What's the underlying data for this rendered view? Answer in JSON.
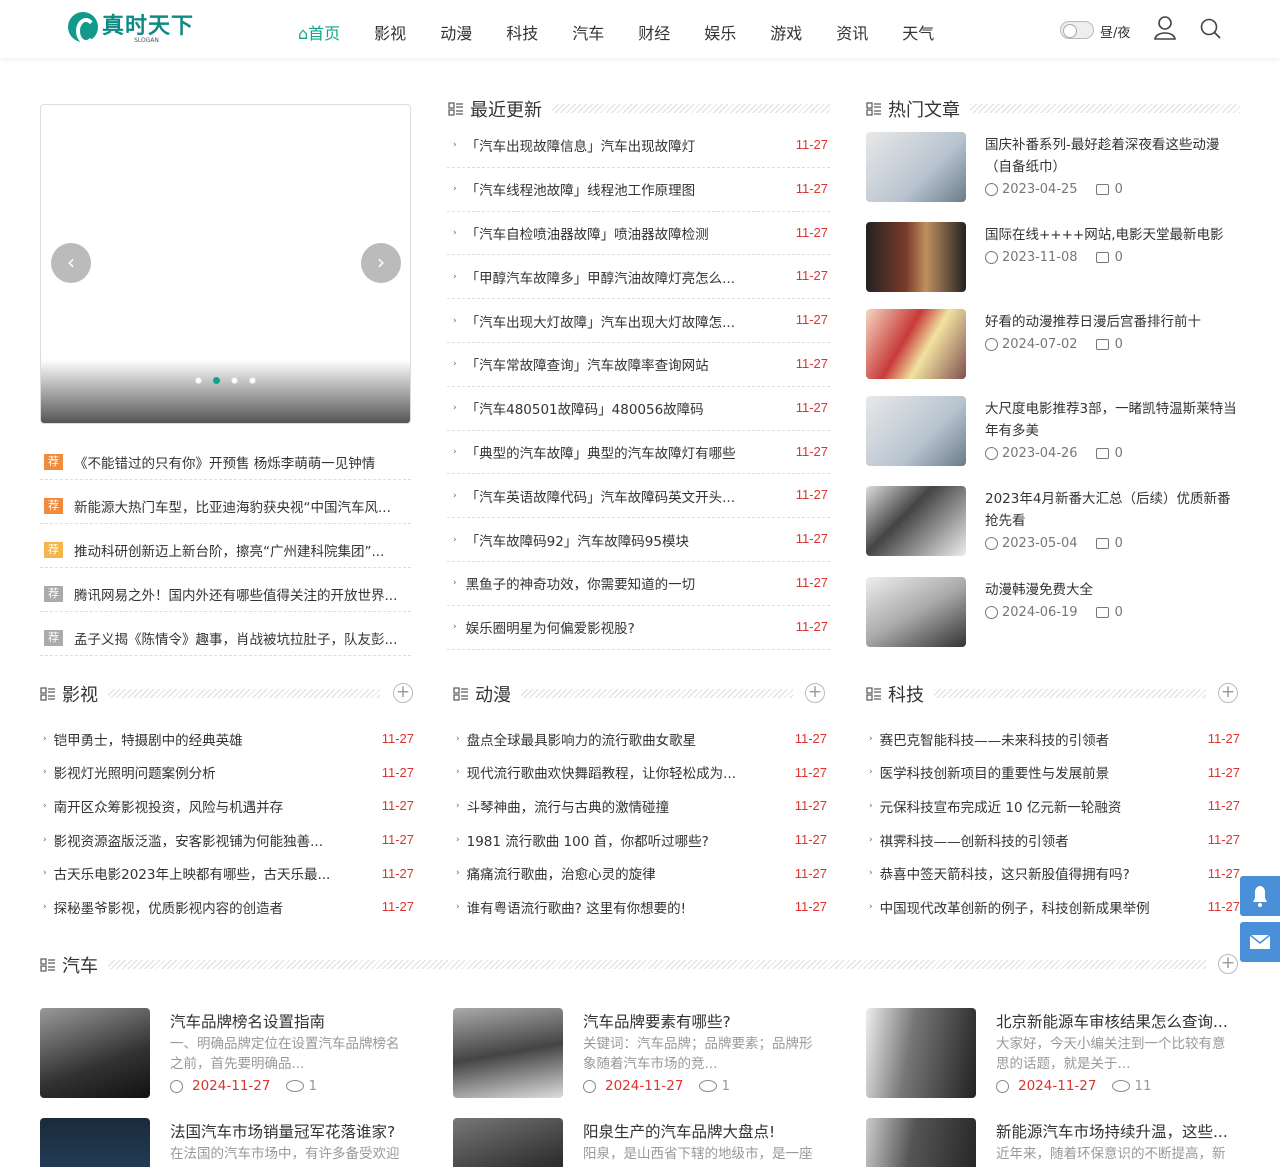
{
  "site": {
    "logo": "真时天下",
    "slogan": "SLOGAN"
  },
  "nav": [
    {
      "label": "⌂首页",
      "active": true
    },
    {
      "label": "影视"
    },
    {
      "label": "动漫"
    },
    {
      "label": "科技"
    },
    {
      "label": "汽车"
    },
    {
      "label": "财经"
    },
    {
      "label": "娱乐"
    },
    {
      "label": "游戏"
    },
    {
      "label": "资讯"
    },
    {
      "label": "天气"
    }
  ],
  "header": {
    "day_night": "昼/夜"
  },
  "slider": {
    "prev": "‹",
    "next": "›",
    "dots": 4,
    "active_dot": 1
  },
  "recommend": {
    "badge": "荐",
    "badge_colors": [
      "#f08a3c",
      "#f08a3c",
      "#f4b54c",
      "#aaaaaa",
      "#aaaaaa"
    ],
    "items": [
      "《不能错过的只有你》开预售 杨烁李萌萌一见钟情",
      "新能源大热门车型，比亚迪海豹获央视“中国汽车风...",
      "推动科研创新迈上新台阶，擦亮“广州建科院集团”...",
      "腾讯网易之外！国内外还有哪些值得关注的开放世界...",
      "孟子义揭《陈情令》趣事，肖战被坑拉肚子，队友彭..."
    ]
  },
  "latest": {
    "title": "最近更新",
    "items": [
      {
        "text": "「汽车出现故障信息」汽车出现故障灯",
        "date": "11-27"
      },
      {
        "text": "「汽车线程池故障」线程池工作原理图",
        "date": "11-27"
      },
      {
        "text": "「汽车自检喷油器故障」喷油器故障检测",
        "date": "11-27"
      },
      {
        "text": "「甲醇汽车故障多」甲醇汽油故障灯亮怎么...",
        "date": "11-27"
      },
      {
        "text": "「汽车出现大灯故障」汽车出现大灯故障怎...",
        "date": "11-27"
      },
      {
        "text": "「汽车常故障查询」汽车故障率查询网站",
        "date": "11-27"
      },
      {
        "text": "「汽车480501故障码」480056故障码",
        "date": "11-27"
      },
      {
        "text": "「典型的汽车故障」典型的汽车故障灯有哪些",
        "date": "11-27"
      },
      {
        "text": "「汽车英语故障代码」汽车故障码英文开头...",
        "date": "11-27"
      },
      {
        "text": "「汽车故障码92」汽车故障码95模块",
        "date": "11-27"
      },
      {
        "text": "黑鱼子的神奇功效，你需要知道的一切",
        "date": "11-27"
      },
      {
        "text": "娱乐圈明星为何偏爱影视股?",
        "date": "11-27"
      }
    ]
  },
  "hot": {
    "title": "热门文章",
    "items": [
      {
        "title": "国庆补番系列-最好趁着深夜看这些动漫（自备纸巾）",
        "date": "2023-04-25",
        "comments": "0"
      },
      {
        "title": "国际在线++++网站,电影天堂最新电影",
        "date": "2023-11-08",
        "comments": "0"
      },
      {
        "title": "好看的动漫推荐日漫后宫番排行前十",
        "date": "2024-07-02",
        "comments": "0"
      },
      {
        "title": "大尺度电影推荐3部，一睹凯特温斯莱特当年有多美",
        "date": "2023-04-26",
        "comments": "0"
      },
      {
        "title": "2023年4月新番大汇总（后续）优质新番抢先看",
        "date": "2023-05-04",
        "comments": "0"
      },
      {
        "title": "动漫韩漫免费大全",
        "date": "2024-06-19",
        "comments": "0"
      }
    ]
  },
  "columns": [
    {
      "title": "影视",
      "items": [
        {
          "text": "铠甲勇士，特摄剧中的经典英雄",
          "date": "11-27"
        },
        {
          "text": "影视灯光照明问题案例分析",
          "date": "11-27"
        },
        {
          "text": "南开区众筹影视投资，风险与机遇并存",
          "date": "11-27"
        },
        {
          "text": "影视资源盗版泛滥，安客影视铺为何能独善...",
          "date": "11-27"
        },
        {
          "text": "古天乐电影2023年上映都有哪些，古天乐最...",
          "date": "11-27"
        },
        {
          "text": "探秘墨爷影视，优质影视内容的创造者",
          "date": "11-27"
        }
      ]
    },
    {
      "title": "动漫",
      "items": [
        {
          "text": "盘点全球最具影响力的流行歌曲女歌星",
          "date": "11-27"
        },
        {
          "text": "现代流行歌曲欢快舞蹈教程，让你轻松成为...",
          "date": "11-27"
        },
        {
          "text": "斗琴神曲，流行与古典的激情碰撞",
          "date": "11-27"
        },
        {
          "text": "1981 流行歌曲 100 首，你都听过哪些?",
          "date": "11-27"
        },
        {
          "text": "痛痛流行歌曲，治愈心灵的旋律",
          "date": "11-27"
        },
        {
          "text": "谁有粤语流行歌曲? 这里有你想要的!",
          "date": "11-27"
        }
      ]
    },
    {
      "title": "科技",
      "items": [
        {
          "text": "赛巴克智能科技——未来科技的引领者",
          "date": "11-27"
        },
        {
          "text": "医学科技创新项目的重要性与发展前景",
          "date": "11-27"
        },
        {
          "text": "元保科技宣布完成近 10 亿元新一轮融资",
          "date": "11-27"
        },
        {
          "text": "祺霁科技——创新科技的引领者",
          "date": "11-27"
        },
        {
          "text": "恭喜中签天箭科技，这只新股值得拥有吗?",
          "date": "11-27"
        },
        {
          "text": "中国现代改革创新的例子，科技创新成果举例",
          "date": "11-27"
        }
      ]
    }
  ],
  "car_section": {
    "title": "汽车",
    "cards": [
      {
        "title": "汽车品牌榜名设置指南",
        "desc": "一、明确品牌定位在设置汽车品牌榜名之前，首先要明确品...",
        "date": "2024-11-27",
        "views": "1"
      },
      {
        "title": "汽车品牌要素有哪些?",
        "desc": "关键词：汽车品牌；品牌要素；品牌形象随着汽车市场的竞...",
        "date": "2024-11-27",
        "views": "1"
      },
      {
        "title": "北京新能源车审核结果怎么查询...",
        "desc": "大家好，今天小编关注到一个比较有意思的话题，就是关于...",
        "date": "2024-11-27",
        "views": "11"
      },
      {
        "title": "法国汽车市场销量冠军花落谁家?",
        "desc": "在法国的汽车市场中，有许多备受欢迎",
        "date": "",
        "views": ""
      },
      {
        "title": "阳泉生产的汽车品牌大盘点!",
        "desc": "阳泉，是山西省下辖的地级市，是一座",
        "date": "",
        "views": ""
      },
      {
        "title": "新能源汽车市场持续升温，这些...",
        "desc": "近年来，随着环保意识的不断提高，新",
        "date": "",
        "views": ""
      }
    ]
  },
  "colors": {
    "accent": "#10a58a",
    "date_red": "#e0332d",
    "float_blue": "#4a90d9"
  }
}
